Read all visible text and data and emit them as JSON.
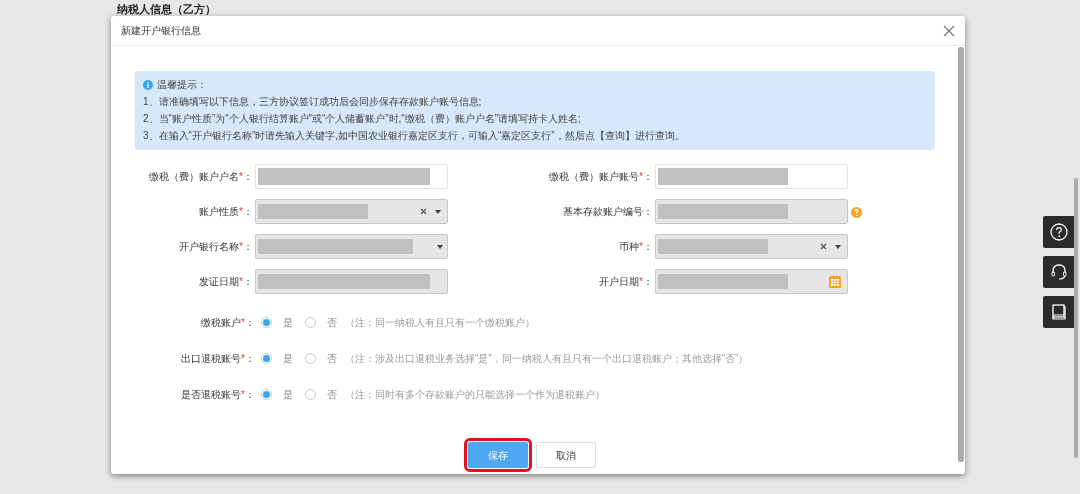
{
  "page_heading": "纳税人信息（乙方）",
  "dialog": {
    "title": "新建开户银行信息",
    "tips": {
      "title": "温馨提示：",
      "lines": [
        "1、请准确填写以下信息，三方协议签订成功后会同步保存存款账户账号信息;",
        "2、当“账户性质”为“个人银行结算账户”或“个人储蓄账户”时,“缴税（费）账户户名”请填写持卡人姓名;",
        "3、在输入“开户银行名称”时请先输入关键字,如中国农业银行嘉定区支行，可输入“嘉定区支行”，然后点【查询】进行查询。"
      ]
    },
    "fields": [
      {
        "label": "缴税（费）账户户名",
        "required": "*",
        "colon": "：",
        "kind": "text",
        "disabled": false,
        "redacted": true,
        "marked": false,
        "help": false
      },
      {
        "label": "缴税（费）账户账号",
        "required": "*",
        "colon": "：",
        "kind": "text",
        "disabled": false,
        "redacted": true,
        "marked": false,
        "help": false
      },
      {
        "label": "账户性质",
        "required": "*",
        "colon": "：",
        "kind": "select",
        "disabled": true,
        "redacted": true,
        "marked": false,
        "help": false
      },
      {
        "label": "基本存款账户编号",
        "colon": "：",
        "kind": "text",
        "disabled": true,
        "redacted": true,
        "marked": false,
        "help": true
      },
      {
        "label": "开户银行名称",
        "required": "*",
        "colon": "：",
        "kind": "select",
        "disabled": true,
        "redacted": true,
        "marked": false,
        "help": false
      },
      {
        "label": "币种",
        "required": "*",
        "colon": "：",
        "kind": "select",
        "disabled": true,
        "redacted": true,
        "marked": false,
        "help": false
      },
      {
        "label": "发证日期",
        "required": "*",
        "colon": "：",
        "kind": "date",
        "disabled": true,
        "redacted": true,
        "marked": false,
        "help": false
      },
      {
        "label": "开户日期",
        "required": "*",
        "colon": "：",
        "kind": "date",
        "disabled": true,
        "redacted": true,
        "marked": true,
        "help": false
      }
    ],
    "radio_groups": [
      {
        "label": "缴税账户",
        "required": "*",
        "colon": "：",
        "options": [
          {
            "label": "是",
            "selected": true
          },
          {
            "label": "否",
            "selected": false
          }
        ],
        "note": "（注：同一纳税人有且只有一个缴税账户）"
      },
      {
        "label": "出口退税账号",
        "required": "*",
        "colon": "：",
        "options": [
          {
            "label": "是",
            "selected": true
          },
          {
            "label": "否",
            "selected": false
          }
        ],
        "note": "（注：涉及出口退税业务选择“是”，同一纳税人有且只有一个出口退税账户；其他选择“否”）"
      },
      {
        "label": "是否退税账号",
        "required": "*",
        "colon": "：",
        "options": [
          {
            "label": "是",
            "selected": true
          },
          {
            "label": "否",
            "selected": false
          }
        ],
        "note": "（注：同时有多个存款账户的只能选择一个作为退税账户）"
      }
    ],
    "buttons": [
      {
        "label": "保存",
        "kind": "primary",
        "highlighted": true
      },
      {
        "label": "取消",
        "kind": "default",
        "highlighted": false
      }
    ]
  },
  "side_tools": [
    {
      "kind": "help"
    },
    {
      "kind": "headset"
    },
    {
      "kind": "book"
    }
  ]
}
